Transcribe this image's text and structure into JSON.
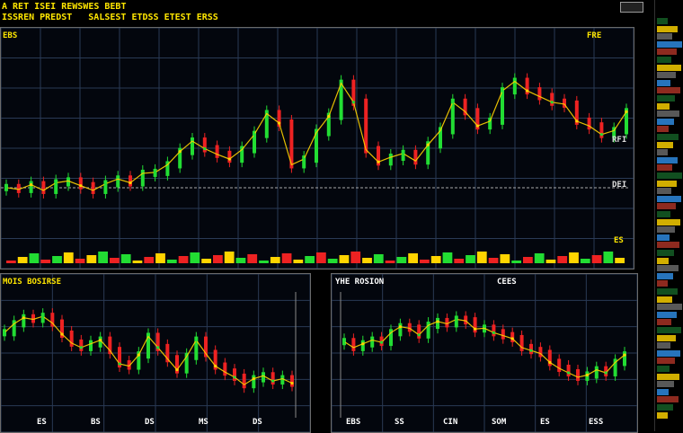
{
  "header": {
    "line1": "A RET ISEI REWSWES BEBT",
    "line2": "ISSREN PREDST",
    "line2_mid": "SALSEST ETDSS ETEST ERSS"
  },
  "main": {
    "label_left": "EBS",
    "label_right": "FRE",
    "right_scale": [
      "RFI",
      "DEI",
      "ES"
    ]
  },
  "left_panel": {
    "title": "MOIS BOSIRSE",
    "x_labels": [
      "ES",
      "BS",
      "DS",
      "MS",
      "DS"
    ]
  },
  "right_panel": {
    "title": "YHE ROSION",
    "title_right": "CEES",
    "x_labels": [
      "EBS",
      "SS",
      "CIN",
      "SOM",
      "ES",
      "ESS"
    ]
  },
  "colors": {
    "up": "#22dd33",
    "down": "#ee2222",
    "warn": "#ffd400",
    "grid": "#2a3a55",
    "text": "#ffe600"
  },
  "chart_data": [
    {
      "type": "line",
      "title": "",
      "xlabel": "",
      "ylabel": "",
      "x": [
        0,
        1,
        2,
        3,
        4,
        5,
        6,
        7,
        8,
        9,
        10,
        11,
        12,
        13,
        14,
        15,
        16,
        17,
        18,
        19,
        20,
        21,
        22,
        23,
        24,
        25,
        26,
        27,
        28,
        29,
        30,
        31,
        32,
        33,
        34,
        35,
        36,
        37,
        38,
        39,
        40,
        41,
        42,
        43,
        44,
        45,
        46,
        47,
        48,
        49,
        50
      ],
      "series": [
        {
          "values": [
            40,
            38,
            43,
            37,
            45,
            47,
            42,
            37,
            44,
            49,
            45,
            55,
            56,
            64,
            78,
            89,
            81,
            75,
            70,
            80,
            96,
            118,
            108,
            64,
            70,
            98,
            115,
            150,
            130,
            80,
            67,
            72,
            76,
            68,
            85,
            100,
            130,
            120,
            105,
            110,
            142,
            152,
            142,
            136,
            130,
            128,
            110,
            105,
            96,
            100,
            120
          ]
        }
      ],
      "ylim": [
        0,
        180
      ]
    },
    {
      "type": "line",
      "title": "",
      "xlabel": "",
      "ylabel": "",
      "x": [
        0,
        1,
        2,
        3,
        4,
        5,
        6,
        7,
        8,
        9,
        10,
        11,
        12,
        13,
        14,
        15,
        16,
        17,
        18,
        19,
        20,
        21,
        22,
        23,
        24,
        25,
        26,
        27,
        28,
        29,
        30
      ],
      "series": [
        {
          "values": [
            100,
            112,
            120,
            118,
            122,
            113,
            98,
            86,
            80,
            85,
            90,
            76,
            58,
            55,
            70,
            95,
            80,
            65,
            50,
            68,
            90,
            72,
            55,
            47,
            40,
            30,
            38,
            42,
            35,
            38,
            32
          ]
        }
      ],
      "ylim": [
        0,
        150
      ]
    },
    {
      "type": "line",
      "title": "",
      "xlabel": "",
      "ylabel": "",
      "x": [
        0,
        1,
        2,
        3,
        4,
        5,
        6,
        7,
        8,
        9,
        10,
        11,
        12,
        13,
        14,
        15,
        16,
        17,
        18,
        19,
        20,
        21,
        22,
        23,
        24,
        25,
        26,
        27,
        28,
        29,
        30
      ],
      "series": [
        {
          "values": [
            88,
            80,
            85,
            90,
            87,
            100,
            108,
            106,
            97,
            110,
            115,
            112,
            118,
            116,
            105,
            106,
            100,
            96,
            92,
            80,
            76,
            72,
            60,
            52,
            46,
            40,
            43,
            50,
            46,
            60,
            70
          ]
        }
      ],
      "ylim": [
        0,
        150
      ]
    }
  ]
}
